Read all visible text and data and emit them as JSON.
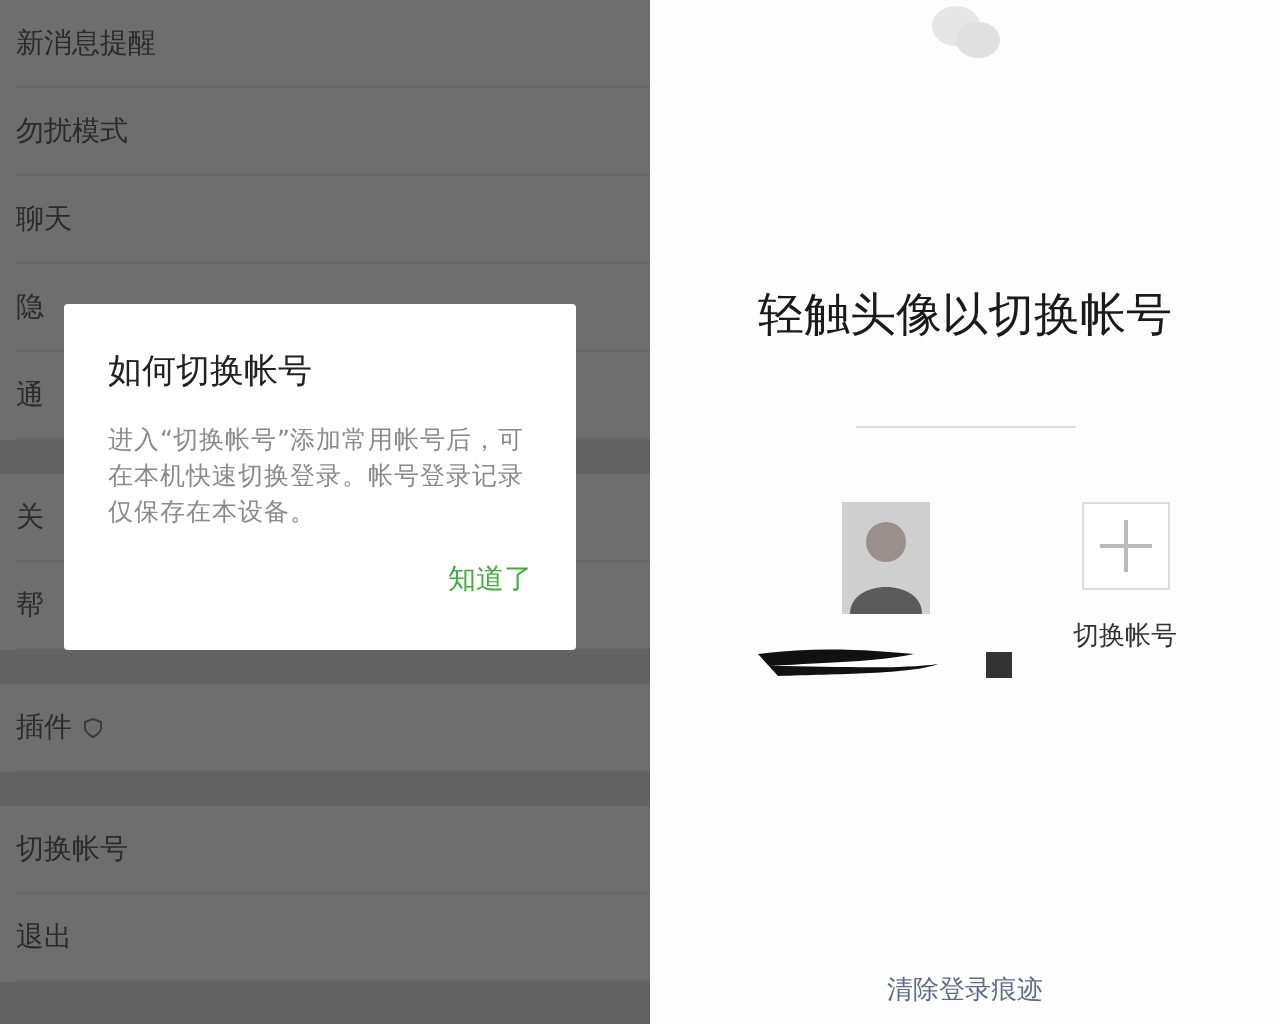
{
  "settings": {
    "groups": [
      {
        "items": [
          {
            "label": "新消息提醒"
          },
          {
            "label": "勿扰模式"
          },
          {
            "label": "聊天"
          },
          {
            "label": "隐"
          },
          {
            "label": "通"
          }
        ]
      },
      {
        "items": [
          {
            "label": "关"
          },
          {
            "label": "帮"
          }
        ]
      },
      {
        "items": [
          {
            "label": "插件",
            "kind": "shield"
          }
        ]
      },
      {
        "items": [
          {
            "label": "切换帐号"
          },
          {
            "label": "退出"
          }
        ]
      }
    ]
  },
  "dialog": {
    "title": "如何切换帐号",
    "message": "进入“切换帐号”添加常用帐号后，可在本机快速切换登录。帐号登录记录仅保存在本设备。",
    "button": "知道了"
  },
  "switch_account": {
    "heading": "轻触头像以切换帐号",
    "add_label": "切换帐号",
    "footer_link": "清除登录痕迹"
  }
}
